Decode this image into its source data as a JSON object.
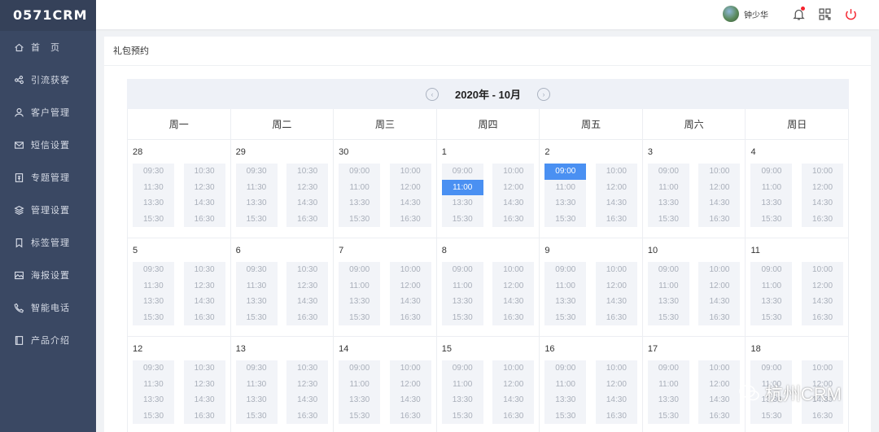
{
  "app": {
    "logo": "0571CRM"
  },
  "sidebar": {
    "items": [
      {
        "label": "首　页",
        "icon": "home-icon"
      },
      {
        "label": "引流获客",
        "icon": "share-icon"
      },
      {
        "label": "客户管理",
        "icon": "user-icon"
      },
      {
        "label": "短信设置",
        "icon": "mail-icon"
      },
      {
        "label": "专题管理",
        "icon": "topic-icon"
      },
      {
        "label": "管理设置",
        "icon": "layers-icon"
      },
      {
        "label": "标签管理",
        "icon": "bookmark-icon"
      },
      {
        "label": "海报设置",
        "icon": "image-icon"
      },
      {
        "label": "智能电话",
        "icon": "phone-icon"
      },
      {
        "label": "产品介绍",
        "icon": "book-icon"
      }
    ]
  },
  "header": {
    "username": "钟少华"
  },
  "page": {
    "title": "礼包预约"
  },
  "calendar": {
    "month_label": "2020年 - 10月",
    "prev": "‹",
    "next": "›",
    "weekdays": [
      "周一",
      "周二",
      "周三",
      "周四",
      "周五",
      "周六",
      "周日"
    ],
    "rows": [
      [
        {
          "day": "28",
          "left": [
            "09:30",
            "11:30",
            "13:30",
            "15:30"
          ],
          "right": [
            "10:30",
            "12:30",
            "14:30",
            "16:30"
          ]
        },
        {
          "day": "29",
          "left": [
            "09:30",
            "11:30",
            "13:30",
            "15:30"
          ],
          "right": [
            "10:30",
            "12:30",
            "14:30",
            "16:30"
          ]
        },
        {
          "day": "30",
          "left": [
            "09:00",
            "11:00",
            "13:30",
            "15:30"
          ],
          "right": [
            "10:00",
            "12:00",
            "14:30",
            "16:30"
          ]
        },
        {
          "day": "1",
          "left": [
            "09:00",
            "11:00",
            "13:30",
            "15:30"
          ],
          "right": [
            "10:00",
            "12:00",
            "14:30",
            "16:30"
          ],
          "selected": "11:00"
        },
        {
          "day": "2",
          "left": [
            "09:00",
            "11:00",
            "13:30",
            "15:30"
          ],
          "right": [
            "10:00",
            "12:00",
            "14:30",
            "16:30"
          ],
          "selected": "09:00"
        },
        {
          "day": "3",
          "left": [
            "09:00",
            "11:00",
            "13:30",
            "15:30"
          ],
          "right": [
            "10:00",
            "12:00",
            "14:30",
            "16:30"
          ]
        },
        {
          "day": "4",
          "left": [
            "09:00",
            "11:00",
            "13:30",
            "15:30"
          ],
          "right": [
            "10:00",
            "12:00",
            "14:30",
            "16:30"
          ]
        }
      ],
      [
        {
          "day": "5",
          "left": [
            "09:30",
            "11:30",
            "13:30",
            "15:30"
          ],
          "right": [
            "10:30",
            "12:30",
            "14:30",
            "16:30"
          ]
        },
        {
          "day": "6",
          "left": [
            "09:30",
            "11:30",
            "13:30",
            "15:30"
          ],
          "right": [
            "10:30",
            "12:30",
            "14:30",
            "16:30"
          ]
        },
        {
          "day": "7",
          "left": [
            "09:00",
            "11:00",
            "13:30",
            "15:30"
          ],
          "right": [
            "10:00",
            "12:00",
            "14:30",
            "16:30"
          ]
        },
        {
          "day": "8",
          "left": [
            "09:00",
            "11:00",
            "13:30",
            "15:30"
          ],
          "right": [
            "10:00",
            "12:00",
            "14:30",
            "16:30"
          ]
        },
        {
          "day": "9",
          "left": [
            "09:00",
            "11:00",
            "13:30",
            "15:30"
          ],
          "right": [
            "10:00",
            "12:00",
            "14:30",
            "16:30"
          ]
        },
        {
          "day": "10",
          "left": [
            "09:00",
            "11:00",
            "13:30",
            "15:30"
          ],
          "right": [
            "10:00",
            "12:00",
            "14:30",
            "16:30"
          ]
        },
        {
          "day": "11",
          "left": [
            "09:00",
            "11:00",
            "13:30",
            "15:30"
          ],
          "right": [
            "10:00",
            "12:00",
            "14:30",
            "16:30"
          ]
        }
      ],
      [
        {
          "day": "12",
          "left": [
            "09:30",
            "11:30",
            "13:30",
            "15:30"
          ],
          "right": [
            "10:30",
            "12:30",
            "14:30",
            "16:30"
          ]
        },
        {
          "day": "13",
          "left": [
            "09:30",
            "11:30",
            "13:30",
            "15:30"
          ],
          "right": [
            "10:30",
            "12:30",
            "14:30",
            "16:30"
          ]
        },
        {
          "day": "14",
          "left": [
            "09:00",
            "11:00",
            "13:30",
            "15:30"
          ],
          "right": [
            "10:00",
            "12:00",
            "14:30",
            "16:30"
          ]
        },
        {
          "day": "15",
          "left": [
            "09:00",
            "11:00",
            "13:30",
            "15:30"
          ],
          "right": [
            "10:00",
            "12:00",
            "14:30",
            "16:30"
          ]
        },
        {
          "day": "16",
          "left": [
            "09:00",
            "11:00",
            "13:30",
            "15:30"
          ],
          "right": [
            "10:00",
            "12:00",
            "14:30",
            "16:30"
          ]
        },
        {
          "day": "17",
          "left": [
            "09:00",
            "11:00",
            "13:30",
            "15:30"
          ],
          "right": [
            "10:00",
            "12:00",
            "14:30",
            "16:30"
          ]
        },
        {
          "day": "18",
          "left": [
            "09:00",
            "11:00",
            "13:30",
            "15:30"
          ],
          "right": [
            "10:00",
            "12:00",
            "14:30",
            "16:30"
          ]
        }
      ]
    ]
  },
  "watermark": {
    "text": "杭州CRM"
  },
  "colors": {
    "sidebar": "#3a4863",
    "accent": "#4a90f2",
    "power": "#f5222d"
  }
}
